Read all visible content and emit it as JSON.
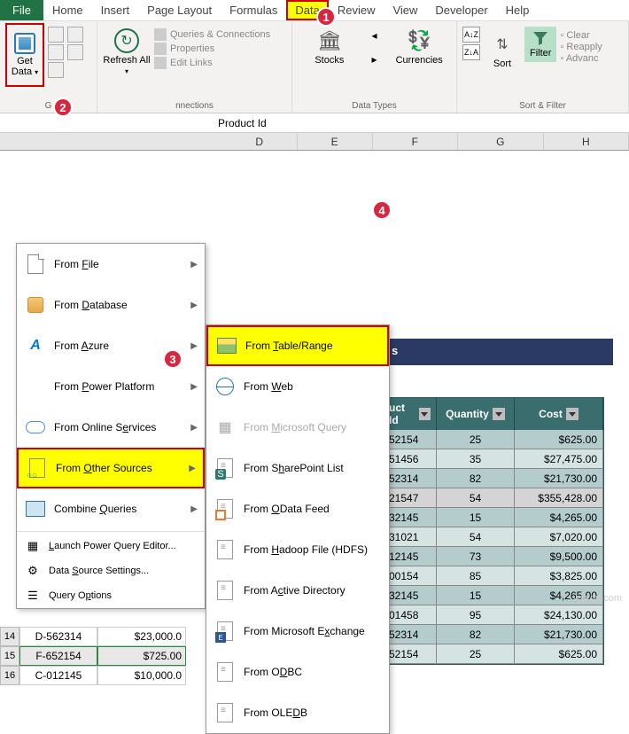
{
  "tabs": {
    "file": "File",
    "home": "Home",
    "insert": "Insert",
    "page_layout": "Page Layout",
    "formulas": "Formulas",
    "data": "Data",
    "review": "Review",
    "view": "View",
    "developer": "Developer",
    "help": "Help"
  },
  "ribbon": {
    "get_data": "Get Data",
    "refresh_all": "Refresh All",
    "queries_connections": "Queries & Connections",
    "properties": "Properties",
    "edit_links": "Edit Links",
    "stocks": "Stocks",
    "currencies": "Currencies",
    "sort": "Sort",
    "filter": "Filter",
    "clear": "Clear",
    "reapply": "Reapply",
    "advanced": "Advanc",
    "group_get": "G",
    "group_conn": "nnections",
    "group_datatypes": "Data Types",
    "group_sortfilter": "Sort & Filter"
  },
  "formula_bar": {
    "value": "Product Id"
  },
  "columns": [
    "D",
    "E",
    "F",
    "G",
    "H"
  ],
  "menu1": {
    "from_file": "From File",
    "from_database": "From Database",
    "from_azure": "From Azure",
    "from_power_platform": "From Power Platform",
    "from_online_services": "From Online Services",
    "from_other_sources": "From Other Sources",
    "combine_queries": "Combine Queries",
    "launch_pq": "Launch Power Query Editor...",
    "ds_settings": "Data Source Settings...",
    "query_options": "Query Options"
  },
  "menu2": {
    "from_table_range": "From Table/Range",
    "from_web": "From Web",
    "from_ms_query": "From Microsoft Query",
    "from_sharepoint": "From SharePoint List",
    "from_odata": "From OData Feed",
    "from_hadoop": "From Hadoop File (HDFS)",
    "from_ad": "From Active Directory",
    "from_exchange": "From Microsoft Exchange",
    "from_odbc": "From ODBC",
    "from_oledb": "From OLEDB"
  },
  "dark_strip": "s",
  "table": {
    "headers": {
      "pid": "uct Id",
      "qty": "Quantity",
      "cost": "Cost"
    },
    "rows": [
      {
        "pid": "52154",
        "qty": "25",
        "cost": "$625.00"
      },
      {
        "pid": "51456",
        "qty": "35",
        "cost": "$27,475.00"
      },
      {
        "pid": "52314",
        "qty": "82",
        "cost": "$21,730.00"
      },
      {
        "pid": "21547",
        "qty": "54",
        "cost": "$355,428.00"
      },
      {
        "pid": "32145",
        "qty": "15",
        "cost": "$4,265.00"
      },
      {
        "pid": "31021",
        "qty": "54",
        "cost": "$7,020.00"
      },
      {
        "pid": "12145",
        "qty": "73",
        "cost": "$9,500.00"
      },
      {
        "pid": "00154",
        "qty": "85",
        "cost": "$3,825.00"
      },
      {
        "pid": "32145",
        "qty": "15",
        "cost": "$4,265.00"
      },
      {
        "pid": "01458",
        "qty": "95",
        "cost": "$24,130.00"
      },
      {
        "pid": "52314",
        "qty": "82",
        "cost": "$21,730.00"
      },
      {
        "pid": "52154",
        "qty": "25",
        "cost": "$625.00"
      }
    ]
  },
  "left_cells": {
    "rows": [
      {
        "num": "14",
        "a": "D-562314",
        "b": "$23,000.0"
      },
      {
        "num": "15",
        "a": "F-652154",
        "b": "$725.00"
      },
      {
        "num": "16",
        "a": "C-012145",
        "b": "$10,000.0"
      }
    ]
  },
  "badges": {
    "b1": "1",
    "b2": "2",
    "b3": "3",
    "b4": "4"
  },
  "watermark": "wsxdn.com"
}
